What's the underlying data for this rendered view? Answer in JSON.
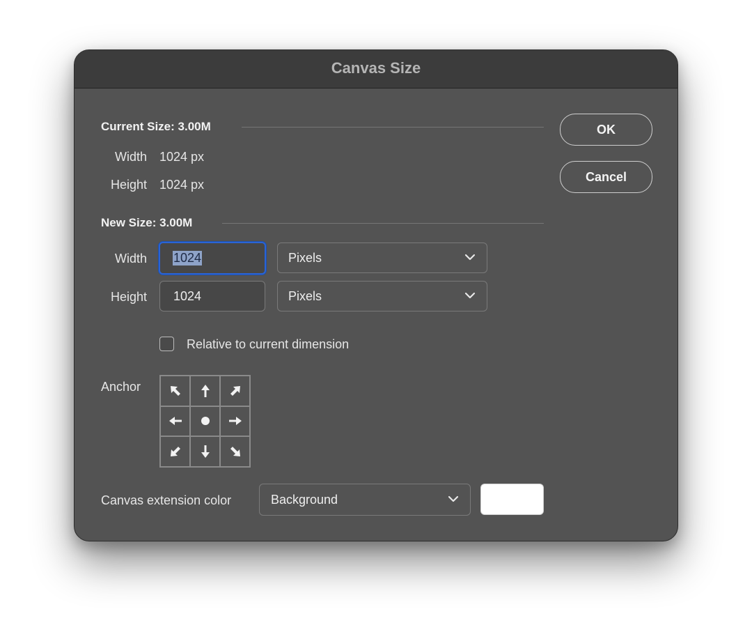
{
  "dialog": {
    "title": "Canvas Size"
  },
  "buttons": {
    "ok_label": "OK",
    "cancel_label": "Cancel"
  },
  "current_size": {
    "heading": "Current Size: 3.00M",
    "width_label": "Width",
    "width_value": "1024 px",
    "height_label": "Height",
    "height_value": "1024 px"
  },
  "new_size": {
    "heading": "New Size: 3.00M",
    "width_label": "Width",
    "width_value": "1024",
    "width_unit": "Pixels",
    "height_label": "Height",
    "height_value": "1024",
    "height_unit": "Pixels",
    "relative_label": "Relative to current dimension",
    "relative_checked": false
  },
  "anchor": {
    "label": "Anchor",
    "selected": "center",
    "cells": [
      {
        "position": "top-left",
        "icon": "arrow-up-left-icon"
      },
      {
        "position": "top",
        "icon": "arrow-up-icon"
      },
      {
        "position": "top-right",
        "icon": "arrow-up-right-icon"
      },
      {
        "position": "left",
        "icon": "arrow-left-icon"
      },
      {
        "position": "center",
        "icon": "dot-icon"
      },
      {
        "position": "right",
        "icon": "arrow-right-icon"
      },
      {
        "position": "bottom-left",
        "icon": "arrow-down-left-icon"
      },
      {
        "position": "bottom",
        "icon": "arrow-down-icon"
      },
      {
        "position": "bottom-right",
        "icon": "arrow-down-right-icon"
      }
    ]
  },
  "extension": {
    "label": "Canvas extension color",
    "value": "Background",
    "swatch_color": "#ffffff"
  },
  "colors": {
    "dialog_bg": "#535353",
    "titlebar_bg": "#3c3c3c",
    "focus_ring": "#2a64d6"
  }
}
